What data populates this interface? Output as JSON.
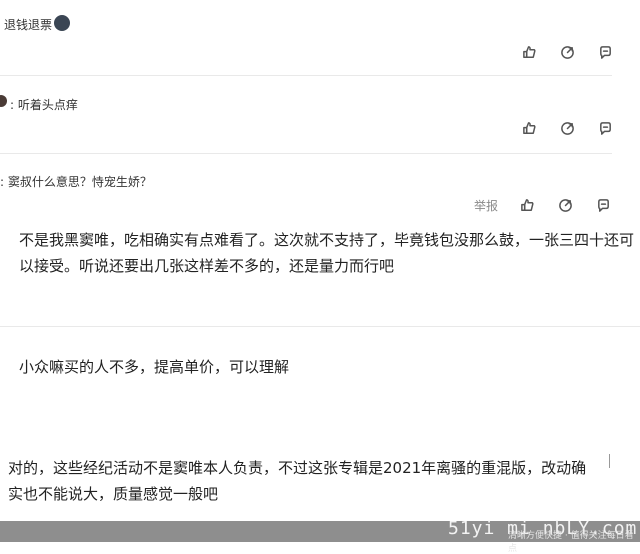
{
  "comments": [
    {
      "text": "退钱退票"
    },
    {
      "text": ": 听着头点痒"
    },
    {
      "text": ": 窦叔什么意思？恃宠生娇？",
      "report_label": "举报",
      "reply": "不是我黑窦唯，吃相确实有点难看了。这次就不支持了，毕竟钱包没那么鼓，一张三四十还可以接受。听说还要出几张这样差不多的，还是量力而行吧"
    },
    {
      "text": "小众嘛买的人不多，提高单价，可以理解"
    },
    {
      "text": "对的，这些经纪活动不是窦唯本人负责，不过这张专辑是2021年离骚的重混版，改动确实也不能说大，质量感觉一般吧"
    }
  ],
  "icons": {
    "like": "thumbs-up-icon",
    "share": "share-icon",
    "comment": "comment-icon"
  },
  "watermark": {
    "main": "51yi mi nbLY.com",
    "sub": "清晰方便快捷 · 值得关注每日看点"
  }
}
